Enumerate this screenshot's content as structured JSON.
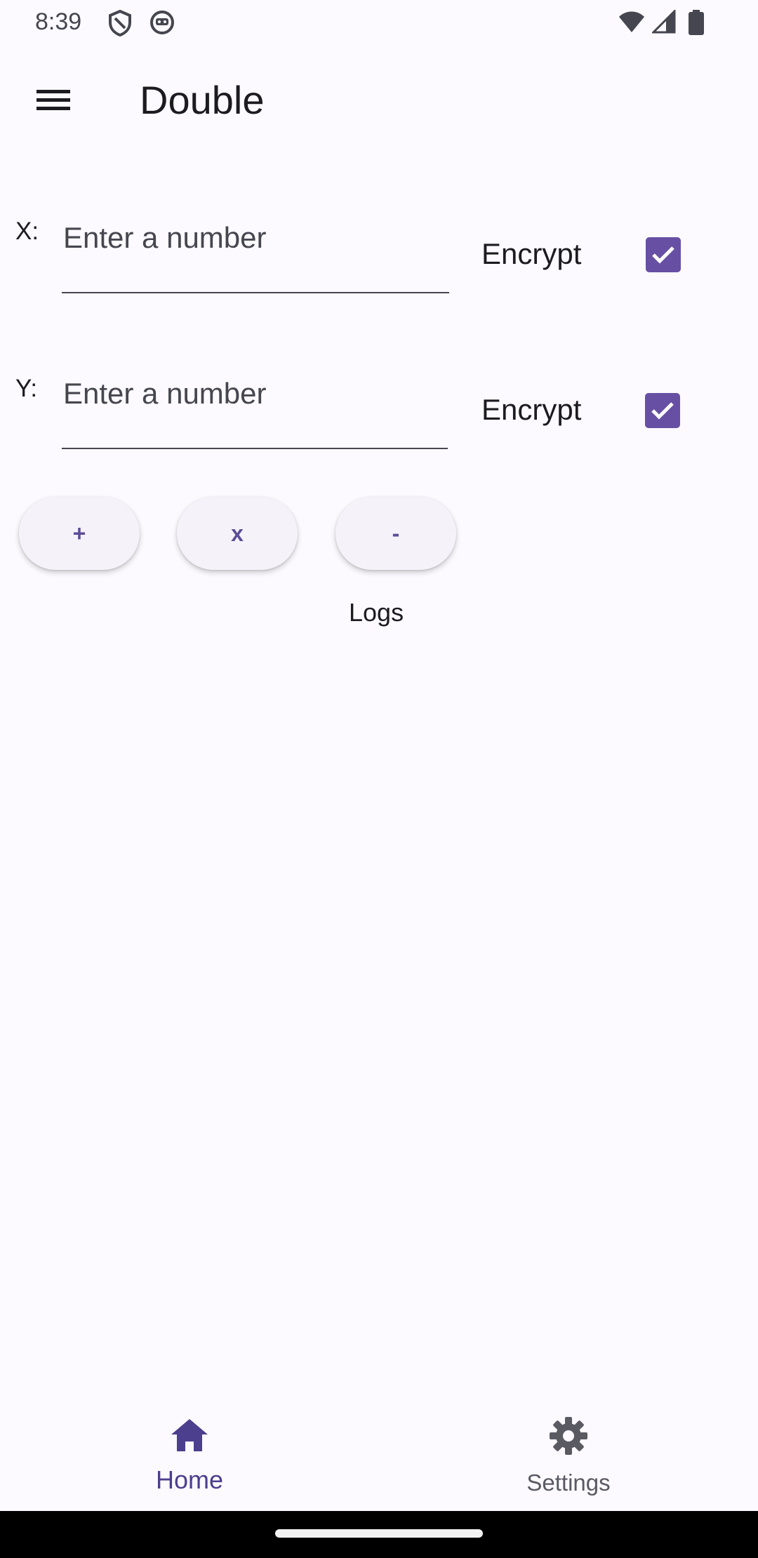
{
  "status_bar": {
    "time": "8:39",
    "icons": [
      "shield-icon",
      "robot-icon",
      "wifi-icon",
      "signal-icon",
      "battery-icon"
    ]
  },
  "app_bar": {
    "title": "Double",
    "menu_icon": "menu-icon"
  },
  "form": {
    "x": {
      "label": "X:",
      "placeholder": "Enter a number",
      "value": "",
      "encrypt_label": "Encrypt",
      "encrypt_checked": true
    },
    "y": {
      "label": "Y:",
      "placeholder": "Enter a number",
      "value": "",
      "encrypt_label": "Encrypt",
      "encrypt_checked": true
    }
  },
  "operations": {
    "add_label": "+",
    "multiply_label": "x",
    "subtract_label": "-"
  },
  "logs": {
    "title": "Logs"
  },
  "bottom_nav": {
    "items": [
      {
        "label": "Home",
        "icon": "home-icon",
        "selected": true
      },
      {
        "label": "Settings",
        "icon": "gear-icon",
        "selected": false
      }
    ]
  },
  "colors": {
    "accent": "#6750a4",
    "accent_text": "#5b4d96",
    "background": "#fcfaff",
    "button_bg": "#f6f2fa",
    "gesture_bar": "#000000"
  }
}
